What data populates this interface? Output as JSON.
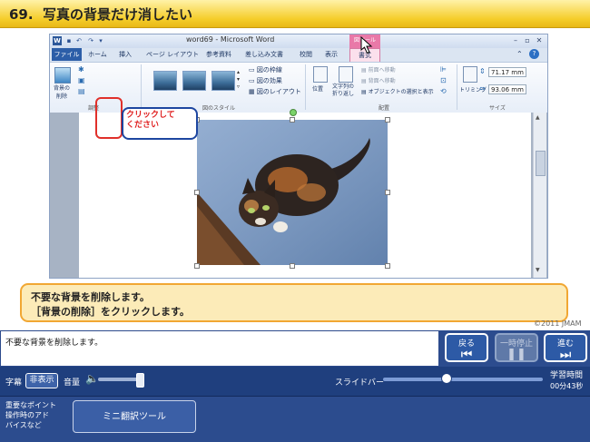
{
  "lesson": {
    "number": "69.",
    "title": "写真の背景だけ消したい"
  },
  "word": {
    "document_title": "word69 - Microsoft Word",
    "context_tab_header": "図ツール",
    "tabs": {
      "file": "ファイル",
      "home": "ホーム",
      "insert": "挿入",
      "page_layout": "ページ レイアウト",
      "references": "参考資料",
      "mailings": "差し込み文書",
      "review": "校閲",
      "view": "表示",
      "format": "書式"
    },
    "ribbon": {
      "remove_background": "背景の\n削除",
      "group_adjust": "調整",
      "group_picture_styles": "図のスタイル",
      "picture_border": "図の枠線",
      "picture_effects": "図の効果",
      "picture_layout": "図のレイアウト",
      "position": "位置",
      "wrap_text": "文字列の\n折り返し",
      "bring_forward": "前面へ移動",
      "send_backward": "背面へ移動",
      "selection_pane": "オブジェクトの選択と表示",
      "group_arrange": "配置",
      "crop": "トリミング",
      "height": "71.17 mm",
      "width": "93.06 mm",
      "group_size": "サイズ"
    },
    "callout": "クリックして\nください"
  },
  "instruction": {
    "line1": "不要な背景を削除します。",
    "line2": "［背景の削除］をクリックします。"
  },
  "copyright": "©2011 JMAM",
  "subtitle": "不要な背景を削除します。",
  "nav": {
    "back": "戻る",
    "pause": "一時停止",
    "next": "進む"
  },
  "controls": {
    "caption_label": "字幕",
    "caption_toggle": "非表示",
    "volume_label": "音量",
    "slider_label": "スライドバー",
    "study_time_label": "学習時間",
    "study_time": "00分43秒",
    "slider_position_pct": 40
  },
  "footer": {
    "tips_link": "重要なポイント\n操作時のアド\nバイスなど",
    "mini_translate": "ミニ翻訳ツール"
  },
  "colors": {
    "title_bar": "#f5cd2a",
    "navy": "#2c4c8e",
    "callout_text": "#e02020",
    "instruction_bg": "#fcebb8"
  }
}
